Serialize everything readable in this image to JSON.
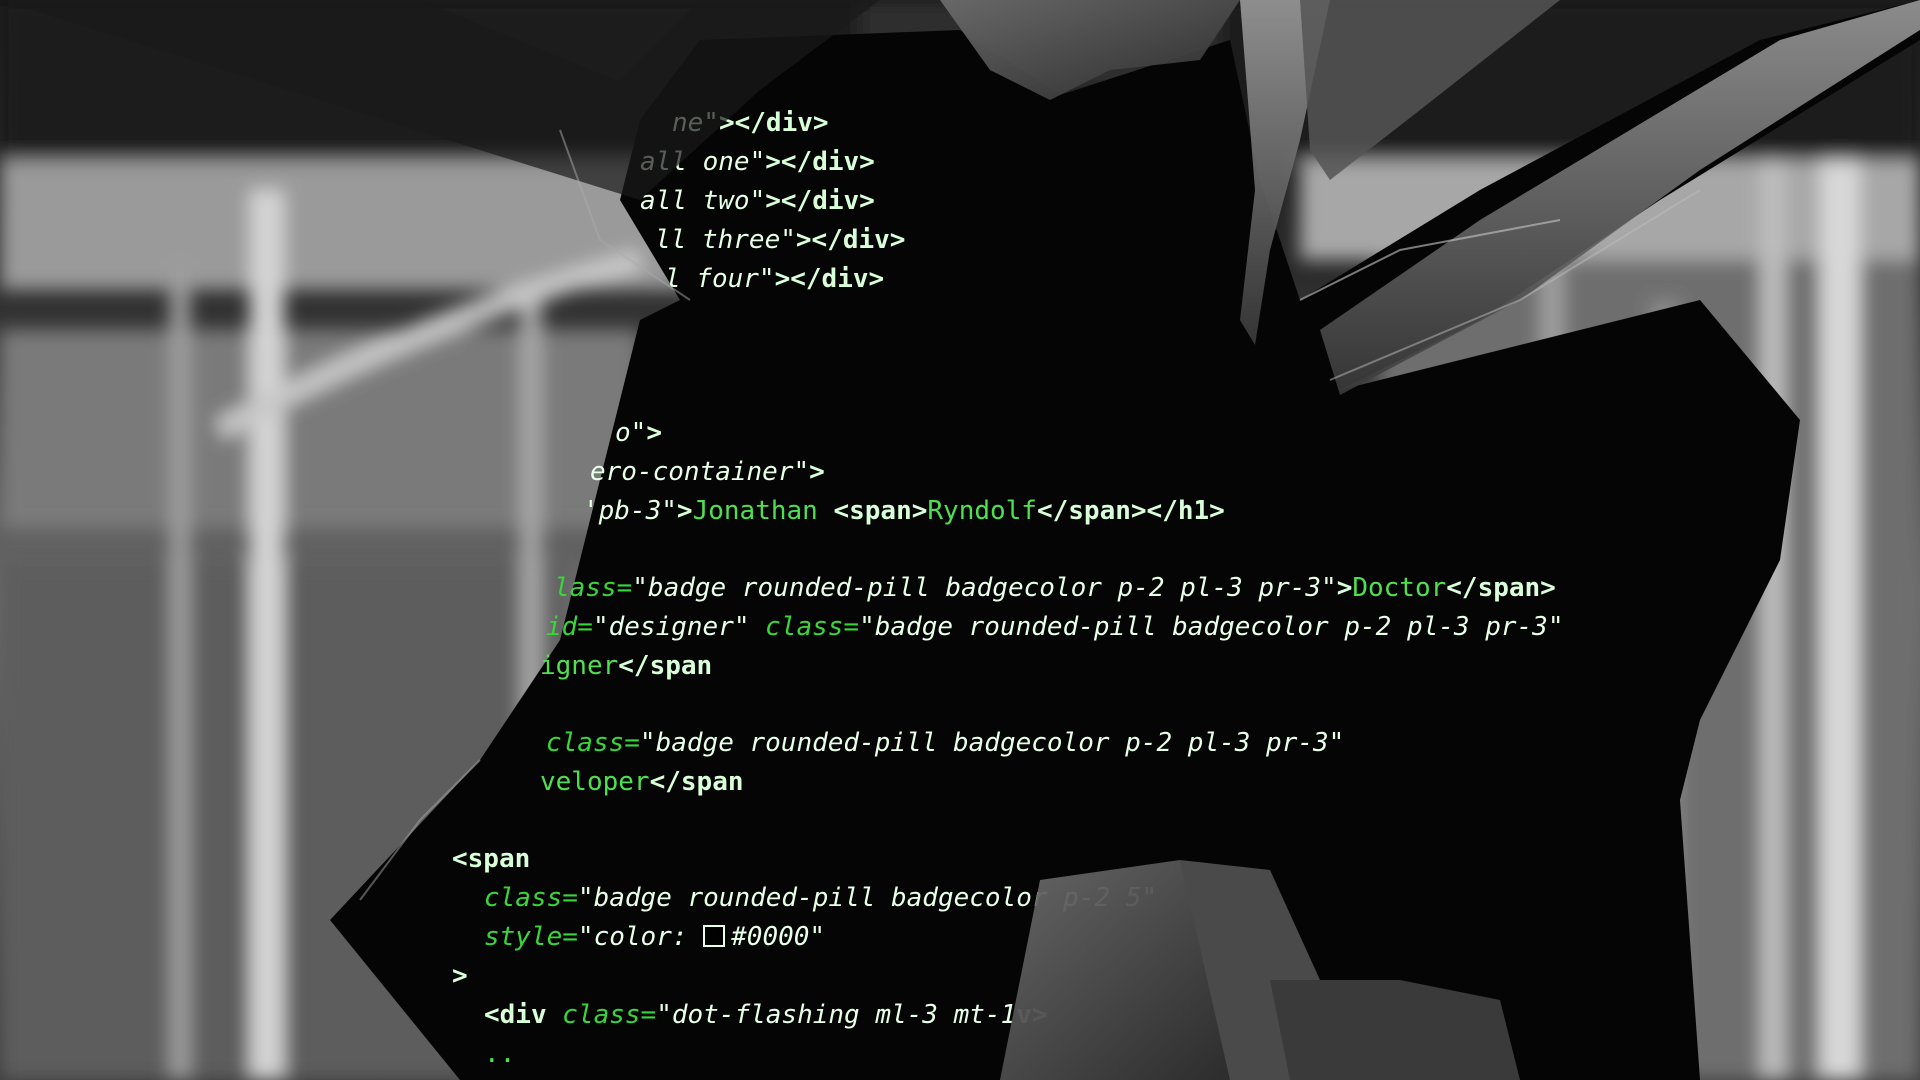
{
  "code": {
    "lines": [
      [
        [
          "str",
          "ne\""
        ],
        [
          "tag",
          "></div>"
        ]
      ],
      [
        [
          "str",
          "all one\""
        ],
        [
          "tag",
          "></div>"
        ]
      ],
      [
        [
          "str",
          "all two\""
        ],
        [
          "tag",
          "></div>"
        ]
      ],
      [
        [
          "str",
          "ll three\""
        ],
        [
          "tag",
          "></div>"
        ]
      ],
      [
        [
          "str",
          "l four\""
        ],
        [
          "tag",
          "></div>"
        ]
      ],
      [
        [
          "str",
          "o\""
        ],
        [
          "tag",
          ">"
        ]
      ],
      [
        [
          "str",
          "ero-container\""
        ],
        [
          "tag",
          ">"
        ]
      ],
      [
        [
          "str",
          "'pb-3\""
        ],
        [
          "tag",
          ">"
        ],
        [
          "text",
          "Jonathan "
        ],
        [
          "tag",
          "<span>"
        ],
        [
          "text",
          "Ryndolf"
        ],
        [
          "tag",
          "</span></h1>"
        ]
      ],
      [
        [
          "attr",
          "lass="
        ],
        [
          "str",
          "\"badge rounded-pill badgecolor p-2 pl-3 pr-3\""
        ],
        [
          "tag",
          ">"
        ],
        [
          "text",
          "Doctor"
        ],
        [
          "tag",
          "</span>"
        ]
      ],
      [
        [
          "attr",
          "id="
        ],
        [
          "str",
          "\"designer\" "
        ],
        [
          "attr",
          "class="
        ],
        [
          "str",
          "\"badge rounded-pill badgecolor p-2 pl-3 pr-3\""
        ]
      ],
      [
        [
          "text",
          "igner"
        ],
        [
          "tag",
          "</span"
        ]
      ],
      [
        [
          "attr",
          "class="
        ],
        [
          "str",
          "\"badge rounded-pill badgecolor p-2 pl-3 pr-3\""
        ]
      ],
      [
        [
          "text",
          "veloper"
        ],
        [
          "tag",
          "</span"
        ]
      ],
      [
        [
          "tag",
          "<span"
        ]
      ],
      [
        [
          "attr",
          "class="
        ],
        [
          "str",
          "\"badge rounded-pill badgecolor p-2 "
        ],
        [
          "str",
          "5\""
        ]
      ],
      [
        [
          "attr",
          "style="
        ],
        [
          "str",
          "\"color: "
        ],
        [
          "swatch",
          ""
        ],
        [
          "str",
          "#0000\""
        ]
      ],
      [
        [
          "tag",
          ">"
        ]
      ],
      [
        [
          "tag",
          "<div "
        ],
        [
          "attr",
          "class="
        ],
        [
          "str",
          "\"dot-flashing ml-3 mt-1"
        ],
        [
          "tag",
          "v>"
        ]
      ],
      [
        [
          "text",
          ".."
        ]
      ]
    ]
  },
  "colors": {
    "code_green": "#5cd65c",
    "tag_color": "#d9ffd9",
    "background": "#0b0b0b"
  }
}
